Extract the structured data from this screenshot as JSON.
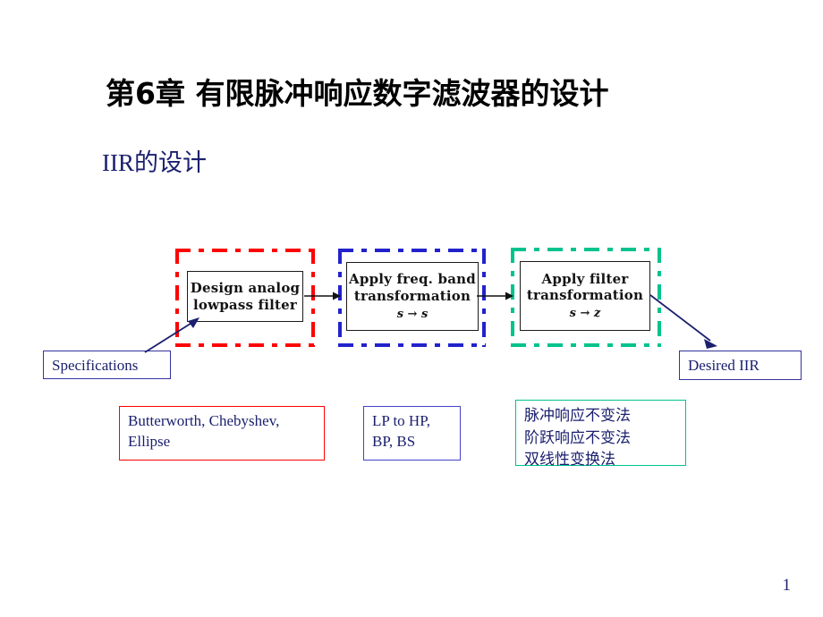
{
  "slide": {
    "title": "第6章 有限脉冲响应数字滤波器的设计",
    "subtitle": "IIR的设计",
    "page_number": "1"
  },
  "colors": {
    "title_text": "#000000",
    "subtitle_text": "#1a1f6e",
    "stage1_frame": "#ff0000",
    "stage2_frame": "#2222cc",
    "stage3_frame": "#00c38d",
    "navy_text": "#1a1f6e",
    "arrow": "#1a1f6e"
  },
  "diagram": {
    "stages": [
      {
        "id": "design-analog-lowpass",
        "frame_color": "#ff0000",
        "line1": "Design analog",
        "line2": "lowpass filter",
        "mapping": ""
      },
      {
        "id": "apply-freq-band-transformation",
        "frame_color": "#2222cc",
        "line1": "Apply freq. band",
        "line2": "transformation",
        "mapping": "s → s"
      },
      {
        "id": "apply-filter-transformation",
        "frame_color": "#00c38d",
        "line1": "Apply filter",
        "line2": "transformation",
        "mapping": "s → z"
      }
    ],
    "input_label": "Specifications",
    "output_label": "Desired IIR",
    "notes": [
      {
        "id": "analog-prototypes",
        "border_color": "#ff0000",
        "lines": [
          "Butterworth, Chebyshev,",
          "Ellipse"
        ]
      },
      {
        "id": "band-transformations",
        "border_color": "#4343c8",
        "lines": [
          "LP to HP,",
          "BP, BS"
        ]
      },
      {
        "id": "discretization-methods",
        "border_color": "#00c38d",
        "lines": [
          "脉冲响应不变法",
          "阶跃响应不变法",
          "双线性变换法"
        ]
      }
    ]
  }
}
